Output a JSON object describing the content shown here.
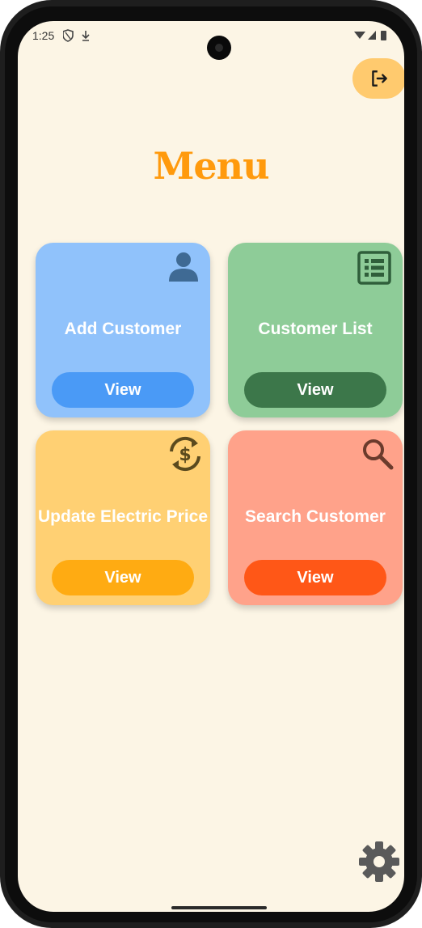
{
  "status_bar": {
    "time": "1:25"
  },
  "header": {
    "logout_icon": "logout-icon"
  },
  "page": {
    "title": "Menu"
  },
  "cards": [
    {
      "label": "Add Customer",
      "button_label": "View",
      "icon": "person-icon",
      "bg_color": "#90c2fb",
      "button_color": "#4a9af6"
    },
    {
      "label": "Customer List",
      "button_label": "View",
      "icon": "list-icon",
      "bg_color": "#8ecc98",
      "button_color": "#3c774a"
    },
    {
      "label": "Update Electric Price",
      "button_label": "View",
      "icon": "currency-exchange-icon",
      "bg_color": "#ffd073",
      "button_color": "#ffab12"
    },
    {
      "label": "Search Customer",
      "button_label": "View",
      "icon": "search-icon",
      "bg_color": "#ffa28a",
      "button_color": "#ff5717"
    }
  ],
  "footer": {
    "settings_icon": "settings-icon"
  },
  "colors": {
    "background": "#fcf5e5",
    "title": "#ff9a0d",
    "logout_button": "#ffca6e"
  }
}
